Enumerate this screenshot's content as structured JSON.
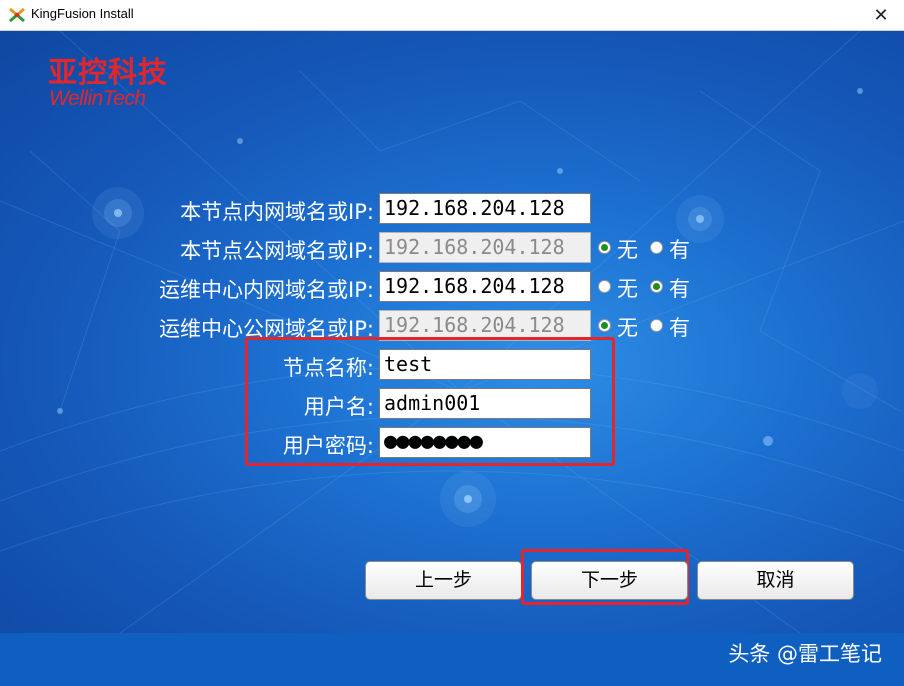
{
  "window": {
    "title": "KingFusion Install",
    "close_glyph": "✕",
    "app_icon": "kingfusion-app-icon"
  },
  "logo": {
    "cn": "亚控科技",
    "en": "WellinTech",
    "color": "#e2272c"
  },
  "form": {
    "rows": [
      {
        "label": "本节点内网域名或IP:",
        "value": "192.168.204.128",
        "disabled": false
      },
      {
        "label": "本节点公网域名或IP:",
        "value": "192.168.204.128",
        "disabled": true,
        "radio": {
          "none": "无",
          "has": "有",
          "selected": "none"
        }
      },
      {
        "label": "运维中心内网域名或IP:",
        "value": "192.168.204.128",
        "disabled": false,
        "radio": {
          "none": "无",
          "has": "有",
          "selected": "has"
        }
      },
      {
        "label": "运维中心公网域名或IP:",
        "value": "192.168.204.128",
        "disabled": true,
        "radio": {
          "none": "无",
          "has": "有",
          "selected": "none"
        }
      },
      {
        "label": "节点名称:",
        "value": "test",
        "disabled": false
      },
      {
        "label": "用户名:",
        "value": "admin001",
        "disabled": false
      },
      {
        "label": "用户密码:",
        "value": "●●●●●●●●",
        "disabled": false
      }
    ]
  },
  "buttons": {
    "prev": "上一步",
    "next": "下一步",
    "cancel": "取消"
  },
  "watermark": "头条 @雷工笔记",
  "colors": {
    "highlight": "#e3262b",
    "radio_selected": "#1e8e1e",
    "background": "#1c6fd0"
  }
}
